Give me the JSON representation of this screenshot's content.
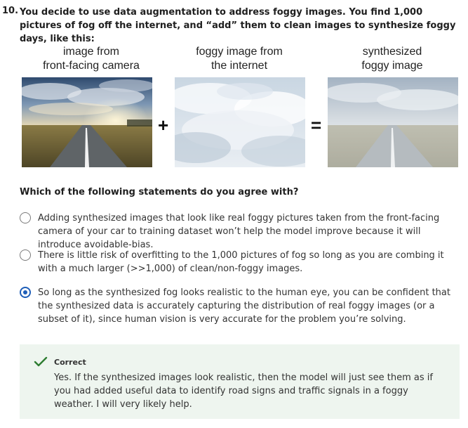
{
  "question": {
    "number": "10.",
    "text": "You decide to use data augmentation to address foggy images. You find 1,000 pictures of fog off the internet, and “add” them to clean images to synthesize foggy days, like this:"
  },
  "figure": {
    "captions": [
      {
        "line1": "image from",
        "line2": "front-facing camera"
      },
      {
        "line1": "foggy image from",
        "line2": "the internet"
      },
      {
        "line1": "synthesized",
        "line2": "foggy image"
      }
    ],
    "plus": "+",
    "equals": "="
  },
  "prompt": "Which of the following statements do you agree with?",
  "options": [
    {
      "text": "Adding synthesized images that look like real foggy pictures taken from the front-facing camera of your car to training dataset won’t help the model improve because it will introduce avoidable-bias.",
      "selected": false
    },
    {
      "text": "There is little risk of overfitting to the 1,000 pictures of fog so long as you are combing it with a much larger (>>1,000) of clean/non-foggy images.",
      "selected": false
    },
    {
      "text": "So long as the synthesized fog looks realistic to the human eye, you can be confident that the synthesized data is accurately capturing the distribution of real foggy images (or a subset of it), since human vision is very accurate for the problem you’re solving.",
      "selected": true
    }
  ],
  "feedback": {
    "status": "Correct",
    "text": "Yes. If the synthesized images look realistic, then the model will just see them as if you had added useful data to identify road signs and traffic signals in a foggy weather. I will very likely help.",
    "icon": "check-icon",
    "accent": "#2e7d32",
    "background": "#eef5ef"
  },
  "colors": {
    "radio_selected": "#1e5eb8"
  }
}
